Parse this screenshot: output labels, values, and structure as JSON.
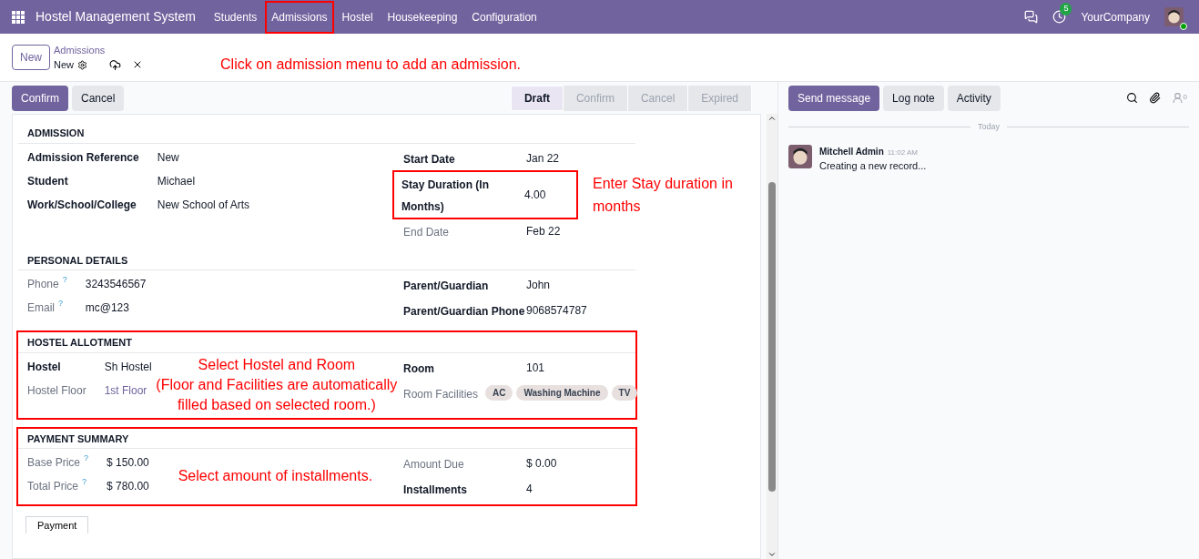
{
  "navbar": {
    "app_title": "Hostel Management System",
    "menu": [
      {
        "label": "Students",
        "highlighted": false
      },
      {
        "label": "Admissions",
        "highlighted": true
      },
      {
        "label": "Hostel",
        "highlighted": false
      },
      {
        "label": "Housekeeping",
        "highlighted": false
      },
      {
        "label": "Configuration",
        "highlighted": false
      }
    ],
    "activity_count": "5",
    "company": "YourCompany"
  },
  "control_panel": {
    "new_button": "New",
    "breadcrumb_parent": "Admissions",
    "breadcrumb_current": "New",
    "annotation": "Click on admission menu to add an admission."
  },
  "action_buttons": [
    {
      "label": "Confirm",
      "kind": "primary"
    },
    {
      "label": "Cancel",
      "kind": "secondary"
    }
  ],
  "stages": [
    {
      "label": "Draft",
      "selected": true
    },
    {
      "label": "Confirm",
      "selected": false
    },
    {
      "label": "Cancel",
      "selected": false
    },
    {
      "label": "Expired",
      "selected": false
    }
  ],
  "sections": [
    {
      "title": "ADMISSION",
      "boxed": false,
      "left": [
        {
          "label": "Admission Reference",
          "value": "New",
          "muted": false
        },
        {
          "label": "Student",
          "value": "Michael",
          "muted": false
        },
        {
          "label": "Work/School/College",
          "value": "New School of Arts",
          "muted": false
        }
      ],
      "right": [
        {
          "label": "Start Date",
          "value": "Jan 22",
          "muted": false,
          "highlighted": false
        },
        {
          "label": "Stay Duration (In Months)",
          "value": "4.00",
          "muted": false,
          "highlighted": true,
          "annotation": "Enter Stay duration in months"
        },
        {
          "label": "End Date",
          "value": "Feb 22",
          "muted": true,
          "highlighted": false
        }
      ]
    },
    {
      "title": "PERSONAL DETAILS",
      "boxed": false,
      "left": [
        {
          "label": "Phone",
          "help": "?",
          "value": "3243546567",
          "muted": true
        },
        {
          "label": "Email",
          "help": "?",
          "value": "mc@123",
          "muted": true
        }
      ],
      "right": [
        {
          "label": "Parent/Guardian",
          "value": "John",
          "muted": false
        },
        {
          "label": "Parent/Guardian Phone",
          "value": "9068574787",
          "muted": false
        }
      ]
    },
    {
      "title": "HOSTEL ALLOTMENT",
      "boxed": true,
      "annotation": "Select Hostel and Room\n(Floor and Facilities are automatically\nfilled based on selected room.)",
      "left": [
        {
          "label": "Hostel",
          "value": "Sh Hostel",
          "muted": false
        },
        {
          "label": "Hostel Floor",
          "value": "1st Floor",
          "muted": true,
          "link": true
        }
      ],
      "right": [
        {
          "label": "Room",
          "value": "101",
          "muted": false
        },
        {
          "label": "Room Facilities",
          "tags": [
            "AC",
            "Washing Machine",
            "TV"
          ],
          "muted": true
        }
      ]
    },
    {
      "title": "PAYMENT SUMMARY",
      "boxed": true,
      "annotation": "Select amount of installments.",
      "left": [
        {
          "label": "Base Price",
          "help": "?",
          "value": "$ 150.00",
          "muted": true
        },
        {
          "label": "Total Price",
          "help": "?",
          "value": "$ 780.00",
          "muted": true
        }
      ],
      "right": [
        {
          "label": "Amount Due",
          "value": "$ 0.00",
          "muted": true
        },
        {
          "label": "Installments",
          "value": "4",
          "muted": false
        }
      ]
    }
  ],
  "notebook_tab": "Payment",
  "chatter": {
    "buttons": [
      {
        "label": "Send message",
        "kind": "primary"
      },
      {
        "label": "Log note",
        "kind": "secondary"
      },
      {
        "label": "Activity",
        "kind": "secondary"
      }
    ],
    "follower_count": "0",
    "date_separator": "Today",
    "messages": [
      {
        "author": "Mitchell Admin",
        "time": "11:02 AM",
        "body": "Creating a new record..."
      }
    ]
  }
}
